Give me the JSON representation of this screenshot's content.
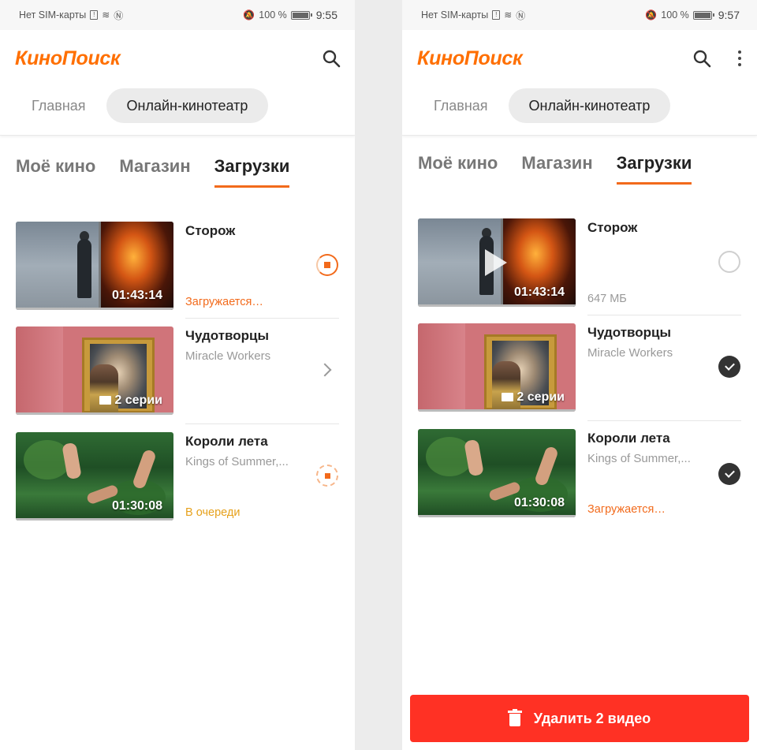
{
  "screens": [
    {
      "status": {
        "carrier": "Нет SIM-карты",
        "battery": "100 %",
        "time": "9:55"
      },
      "logo": "КиноПоиск",
      "nav": [
        "Главная",
        "Онлайн-кинотеатр"
      ],
      "tabs": [
        "Моё кино",
        "Магазин",
        "Загрузки"
      ],
      "items": [
        {
          "title": "Сторож",
          "subtitle": "",
          "thumb_label": "01:43:14",
          "status": "Загружается…"
        },
        {
          "title": "Чудотворцы",
          "subtitle": "Miracle Workers",
          "thumb_label": "2 серии",
          "status": ""
        },
        {
          "title": "Короли лета",
          "subtitle": "Kings of Summer,...",
          "thumb_label": "01:30:08",
          "status": "В очереди"
        }
      ]
    },
    {
      "status": {
        "carrier": "Нет SIM-карты",
        "battery": "100 %",
        "time": "9:57"
      },
      "logo": "КиноПоиск",
      "nav": [
        "Главная",
        "Онлайн-кинотеатр"
      ],
      "tabs": [
        "Моё кино",
        "Магазин",
        "Загрузки"
      ],
      "items": [
        {
          "title": "Сторож",
          "subtitle": "",
          "thumb_label": "01:43:14",
          "status": "647 МБ"
        },
        {
          "title": "Чудотворцы",
          "subtitle": "Miracle Workers",
          "thumb_label": "2 серии",
          "status": ""
        },
        {
          "title": "Короли лета",
          "subtitle": "Kings of Summer,...",
          "thumb_label": "01:30:08",
          "status": "Загружается…"
        }
      ],
      "delete_button": "Удалить 2 видео"
    }
  ],
  "colors": {
    "brand": "#ff6f00",
    "accent": "#f26a1b",
    "delete": "#ff3124"
  }
}
